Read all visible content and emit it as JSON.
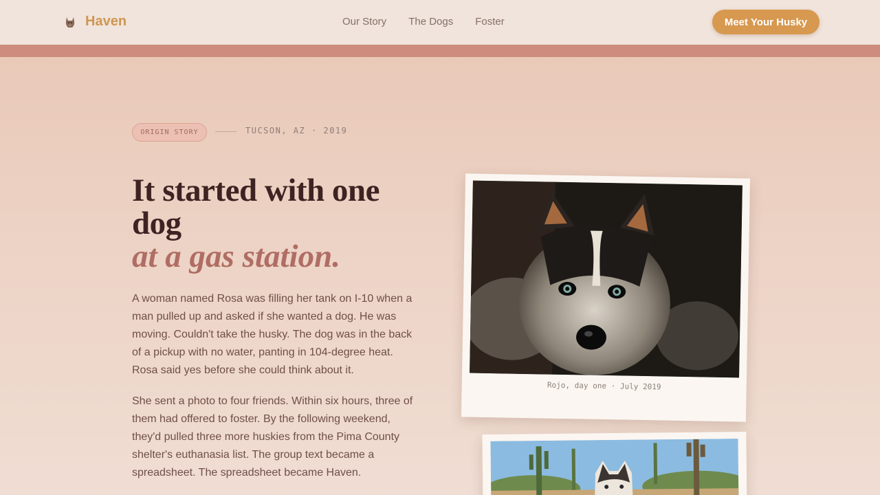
{
  "nav": {
    "brand_name": "Haven",
    "brand_icon": "dog-icon",
    "links": [
      "Our Story",
      "The Dogs",
      "Foster"
    ],
    "cta_label": "Meet Your Husky"
  },
  "colors": {
    "accent": "#d7984f",
    "band": "#cd8c7e",
    "headline": "#3e2323",
    "headline_accent": "#b06d63"
  },
  "hero": {
    "badge": "ORIGIN STORY",
    "location": "TUCSON, AZ · 2019",
    "headline_line1": "It started with one dog",
    "headline_line2": "at a gas station.",
    "paragraphs": [
      "A woman named Rosa was filling her tank on I-10 when a man pulled up and asked if she wanted a dog. He was moving. Couldn't take the husky. The dog was in the back of a pickup with no water, panting in 104-degree heat. Rosa said yes before she could think about it.",
      "She sent a photo to four friends. Within six hours, three of them had offered to foster. By the following weekend, they'd pulled three more huskies from the Pima County shelter's euthanasia list. The group text became a spreadsheet. The spreadsheet became Haven."
    ]
  },
  "photos": {
    "first_caption": "Rojo, day one · July 2019"
  }
}
